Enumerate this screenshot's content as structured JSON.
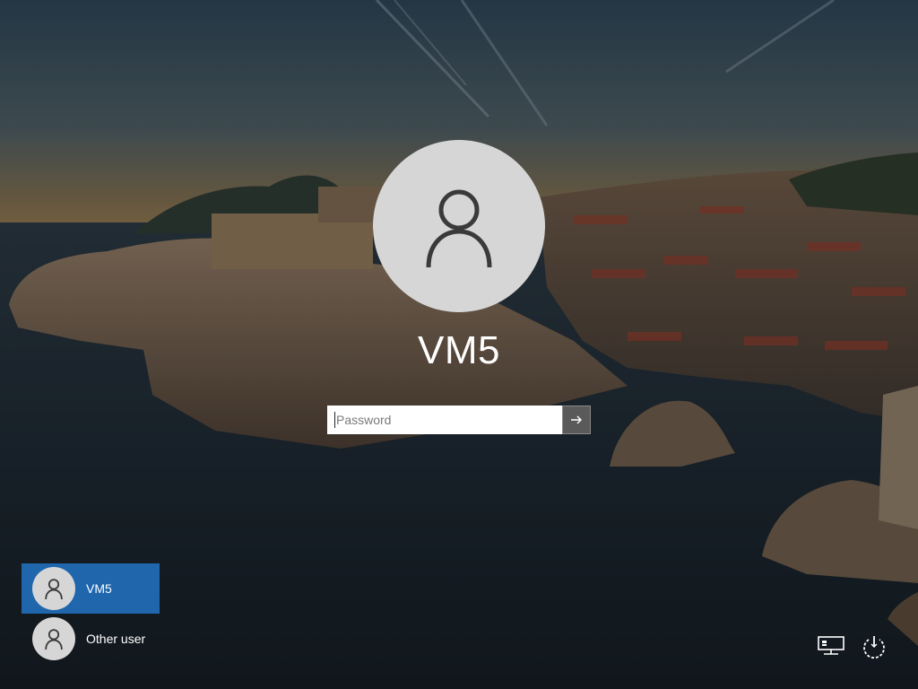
{
  "background": {
    "description": "lock screen wallpaper",
    "sky_color": "#3f5566",
    "sea_color": "#1d2a34"
  },
  "current_user": {
    "name": "VM5",
    "avatar_icon": "user-silhouette-icon"
  },
  "password": {
    "placeholder": "Password",
    "value": "",
    "submit_icon": "arrow-right-icon"
  },
  "user_list": [
    {
      "name": "VM5",
      "selected": true,
      "icon": "user-silhouette-icon"
    },
    {
      "name": "Other user",
      "selected": false,
      "icon": "user-silhouette-icon"
    }
  ],
  "tray": {
    "network_icon": "network-icon",
    "power_icon": "power-icon"
  },
  "colors": {
    "selected_user_bg": "#1f66ad",
    "avatar_bg": "#d6d6d6",
    "submit_bg": "#5a5a5a"
  }
}
